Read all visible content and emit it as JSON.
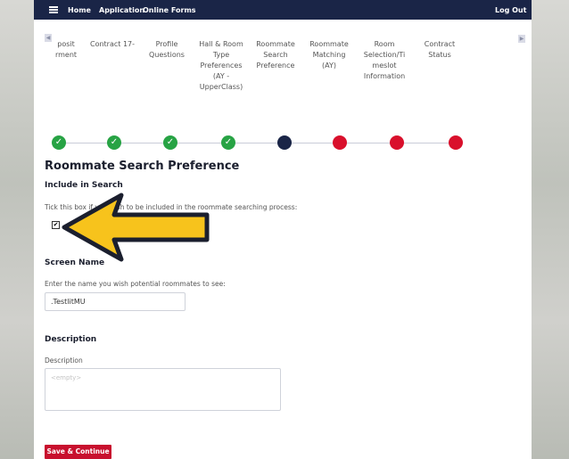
{
  "nav": {
    "home": "Home",
    "application": "Application",
    "online_forms": "Online Forms",
    "logout": "Log Out"
  },
  "steps": [
    {
      "label": "posit\nrment",
      "status": "complete"
    },
    {
      "label": "Contract 17-",
      "status": "complete"
    },
    {
      "label": "Profile\nQuestions",
      "status": "complete"
    },
    {
      "label": "Hall & Room\nType\nPreferences\n(AY -\nUpperClass)",
      "status": "complete"
    },
    {
      "label": "Roommate\nSearch\nPreference",
      "status": "current"
    },
    {
      "label": "Roommate\nMatching\n(AY)",
      "status": "incomplete"
    },
    {
      "label": "Room\nSelection/Ti\nmeslot\nInformation",
      "status": "incomplete"
    },
    {
      "label": "Contract\nStatus",
      "status": "incomplete"
    }
  ],
  "icons": {
    "check": "✓",
    "scroll_left": "◀",
    "scroll_right": "▶",
    "checkbox_mark": "✔"
  },
  "colors": {
    "complete": "#27a344",
    "current": "#1a2547",
    "incomplete": "#d9102c",
    "arrow_fill": "#f7c31c"
  },
  "form": {
    "title": "Roommate Search Preference",
    "include_label": "Include in Search",
    "include_help": "Tick this box if you wish to be included in the roommate searching process:",
    "include_checked": true,
    "screen_name_label": "Screen Name",
    "screen_name_help": "Enter the name you wish potential roommates to see:",
    "screen_name_value": ".TestlitMU",
    "description_label": "Description",
    "description_help": "Description",
    "description_placeholder": "<empty>",
    "save_label": "Save & Continue"
  }
}
